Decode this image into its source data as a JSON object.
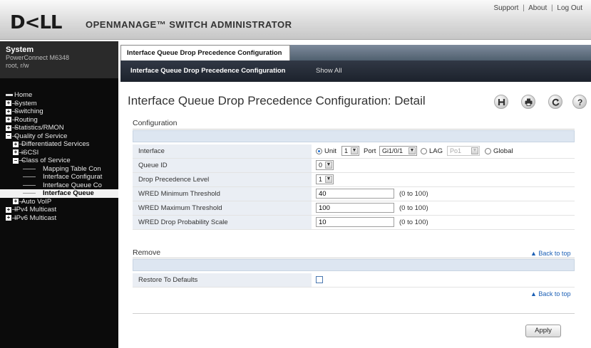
{
  "header": {
    "logo_text": "D<LL",
    "app_title": "OPENMANAGE™ SWITCH ADMINISTRATOR",
    "links": [
      "Support",
      "About",
      "Log Out"
    ],
    "separator": "|"
  },
  "sidebar": {
    "system_title": "System",
    "system_model": "PowerConnect M6348",
    "system_user": "root, r/w",
    "tree": [
      {
        "label": "Home",
        "level": 0,
        "icon": "home-icon"
      },
      {
        "label": "System",
        "level": 0,
        "icon": "expand-icon"
      },
      {
        "label": "Switching",
        "level": 0,
        "icon": "expand-icon"
      },
      {
        "label": "Routing",
        "level": 0,
        "icon": "expand-icon"
      },
      {
        "label": "Statistics/RMON",
        "level": 0,
        "icon": "expand-icon"
      },
      {
        "label": "Quality of Service",
        "level": 0,
        "icon": "collapse-icon"
      },
      {
        "label": "Differentiated Services",
        "level": 1,
        "icon": "expand-icon"
      },
      {
        "label": "iSCSI",
        "level": 1,
        "icon": "expand-icon"
      },
      {
        "label": "Class of Service",
        "level": 1,
        "icon": "collapse-icon"
      },
      {
        "label": "Mapping Table Con",
        "level": 2,
        "icon": ""
      },
      {
        "label": "Interface Configurat",
        "level": 2,
        "icon": ""
      },
      {
        "label": "Interface Queue Co",
        "level": 2,
        "icon": ""
      },
      {
        "label": "Interface Queue",
        "level": 2,
        "icon": "",
        "selected": true
      },
      {
        "label": "Auto VoIP",
        "level": 1,
        "icon": "expand-icon"
      },
      {
        "label": "IPv4 Multicast",
        "level": 0,
        "icon": "expand-icon"
      },
      {
        "label": "IPv6 Multicast",
        "level": 0,
        "icon": "expand-icon"
      }
    ]
  },
  "tabs": {
    "main_tab": "Interface Queue Drop Precedence Configuration",
    "sub_tabs": [
      "Interface Queue Drop Precedence Configuration",
      "Show All"
    ]
  },
  "page": {
    "title": "Interface Queue Drop Precedence Configuration: Detail",
    "tools": [
      "help-icon-h",
      "print-icon",
      "refresh-icon",
      "question-icon"
    ]
  },
  "configuration": {
    "section_title": "Configuration",
    "interface_label": "Interface",
    "unit_label": "Unit",
    "unit_value": "1",
    "port_label": "Port",
    "port_value": "Gi1/0/1",
    "lag_label": "LAG",
    "lag_value": "Po1",
    "global_label": "Global",
    "selected_scope": "Unit",
    "queue_id_label": "Queue ID",
    "queue_id_value": "0",
    "drop_level_label": "Drop Precedence Level",
    "drop_level_value": "1",
    "wred_min_label": "WRED Minimum Threshold",
    "wred_min_value": "40",
    "wred_min_range": "(0 to 100)",
    "wred_max_label": "WRED Maximum Threshold",
    "wred_max_value": "100",
    "wred_max_range": "(0 to 100)",
    "wred_prob_label": "WRED Drop Probability Scale",
    "wred_prob_value": "10",
    "wred_prob_range": "(0 to 100)"
  },
  "remove": {
    "section_title": "Remove",
    "restore_label": "Restore To Defaults",
    "restore_checked": false
  },
  "back_to_top": "Back to top",
  "apply_label": "Apply",
  "colors": {
    "label_bg": "#eaeef4",
    "blank_row_bg": "#dde6f1",
    "link": "#1b5fb5",
    "sidebar_bg": "#0b0b0b"
  }
}
